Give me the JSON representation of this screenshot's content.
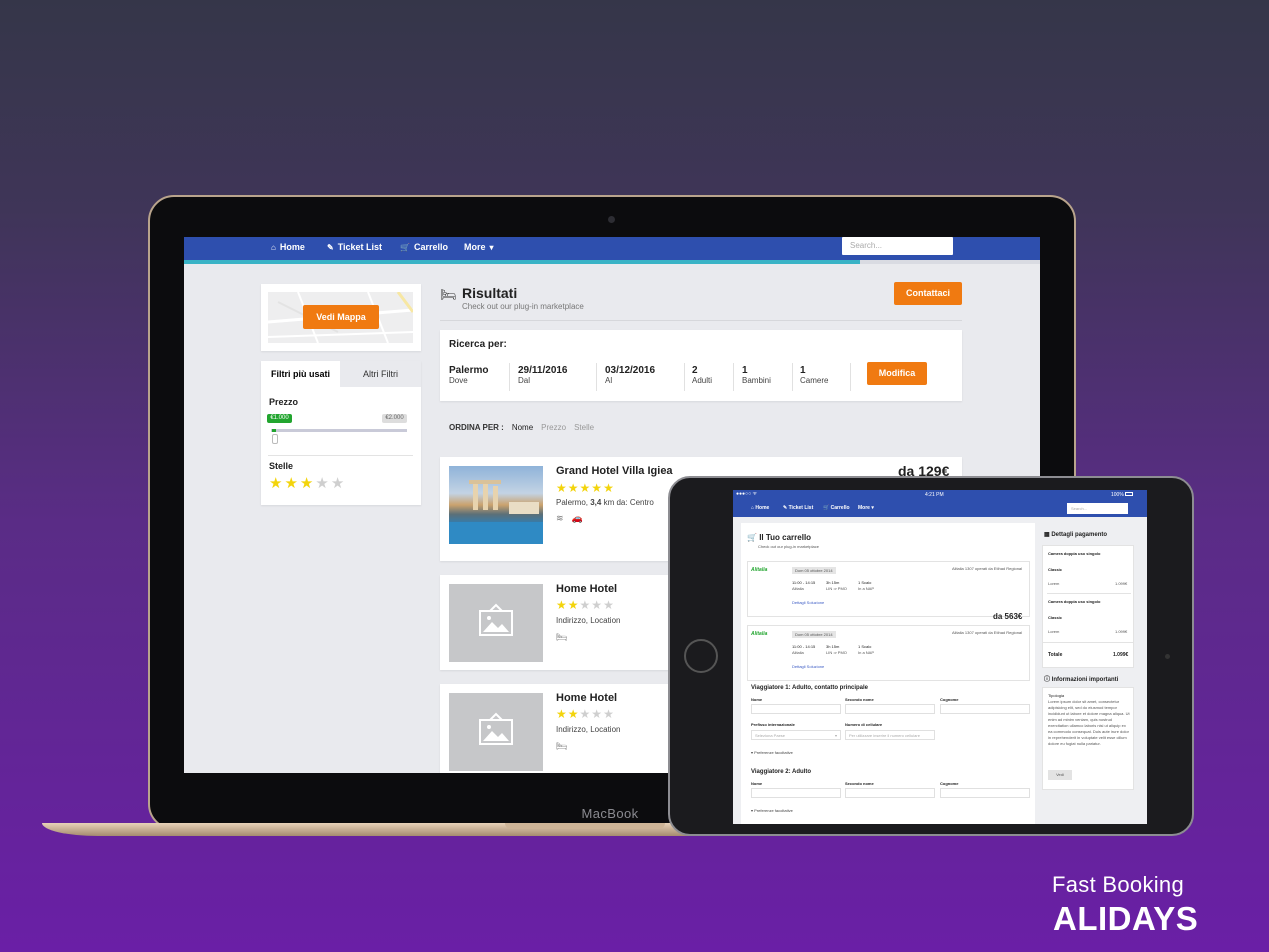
{
  "nav": {
    "items": [
      "Home",
      "Ticket List",
      "Carrello",
      "More"
    ],
    "search_placeholder": "Search..."
  },
  "progress": {
    "percent": 79
  },
  "map": {
    "button": "Vedi Mappa"
  },
  "filters": {
    "tabs": [
      "Filtri più usati",
      "Altri Filtri"
    ],
    "price_label": "Prezzo",
    "price_min": "€1.000",
    "price_max": "€2.000",
    "stars_label": "Stelle",
    "stars_rating": 3
  },
  "results": {
    "title": "Risultati",
    "subtitle": "Check out our plug-in marketplace",
    "contact_button": "Contattaci"
  },
  "search": {
    "heading": "Ricerca per:",
    "fields": [
      {
        "value": "Palermo",
        "label": "Dove"
      },
      {
        "value": "29/11/2016",
        "label": "Dal"
      },
      {
        "value": "03/12/2016",
        "label": "Al"
      },
      {
        "value": "2",
        "label": "Adulti"
      },
      {
        "value": "1",
        "label": "Bambini"
      },
      {
        "value": "1",
        "label": "Camere"
      }
    ],
    "modify_button": "Modifica"
  },
  "sort": {
    "label": "ORDINA PER :",
    "options": [
      "Nome",
      "Prezzo",
      "Stelle"
    ]
  },
  "hotels": [
    {
      "name": "Grand Hotel Villa Igiea",
      "stars": 5,
      "address_prefix": "Palermo, ",
      "distance": "3,4",
      "address_suffix": " km da: Centro",
      "price": "da 129€"
    },
    {
      "name": "Home Hotel",
      "stars": 2,
      "address": "Indirizzo, Location"
    },
    {
      "name": "Home Hotel",
      "stars": 2,
      "address": "Indirizzo, Location"
    }
  ],
  "laptop_label": "MacBook",
  "tablet": {
    "status_time": "4:21 PM",
    "status_battery": "100%",
    "nav": [
      "Home",
      "Ticket List",
      "Carrello",
      "More"
    ],
    "search_placeholder": "Search...",
    "cart_title": "Il Tuo carrello",
    "cart_subtitle": "Check out our plug-in marketplace",
    "flights": [
      {
        "airline": "Alitalia",
        "date": "Dom 05 ottobre 2014",
        "operator": "Alitalia 1307 operati da Etihad Regional",
        "times": "11:00 - 14:15",
        "duration": "3h 15m",
        "route": "LIN ⇒ PMO",
        "stops": "1 Scalo",
        "stops_sub": "In a NAP",
        "details": "Dettagli Soluzione"
      },
      {
        "airline": "Alitalia",
        "date": "Dom 05 ottobre 2014",
        "operator": "Alitalia 1307 operati da Etihad Regional",
        "times": "11:00 - 14:15",
        "duration": "3h 15m",
        "route": "LIN ⇒ PMO",
        "stops": "1 Scalo",
        "stops_sub": "In a NAP",
        "details": "Dettagli Soluzione"
      }
    ],
    "flight_price": "da 563€",
    "traveler1": "Viaggiatore 1: Adulto, contatto principale",
    "traveler2": "Viaggiatore 2: Adulto",
    "field_labels": [
      "Nome",
      "Secondo nome",
      "Cognome"
    ],
    "phone_labels": [
      "Prefisso internazionale",
      "Numero di cellulare"
    ],
    "prefix_placeholder": "Seleziona Paese",
    "phone_placeholder": "Per utilizzare inserire il numero cellulare",
    "preferences": "Preferenze facoltative",
    "payment_title": "Dettagli pagamento",
    "payment_items": [
      {
        "room": "Camera doppia uso singolo",
        "type": "Classic",
        "label": "Lorem",
        "price": "1.099€"
      },
      {
        "room": "Camera doppia uso singolo",
        "type": "Classic",
        "label": "Lorem",
        "price": "1.099€"
      }
    ],
    "total_label": "Totale",
    "total_value": "1.099€",
    "info_title": "Informazioni importanti",
    "info_heading": "Tipologia",
    "info_text": "Lorem ipsum dolor sit amet, consectetur adipisicing elit, sed do eiusmod tempor incididunt ut labore et dolore magna aliqua. Ut enim ad minim veniam, quis nostrud exercitation ullamco laboris nisi ut aliquip ex ea commodo consequat. Duis aute irure dolor in reprehenderit in voluptate velit esse cillum dolore eu fugiat nulla pariatur.",
    "info_button": "Vedi"
  },
  "brand": {
    "line1": "Fast Booking",
    "line2": "ALIDAYS"
  },
  "colors": {
    "nav": "#2e4fae",
    "accent": "#f07a11",
    "progress": "#39b3c6",
    "star": "#f3d40c",
    "badge": "#22a52f"
  }
}
